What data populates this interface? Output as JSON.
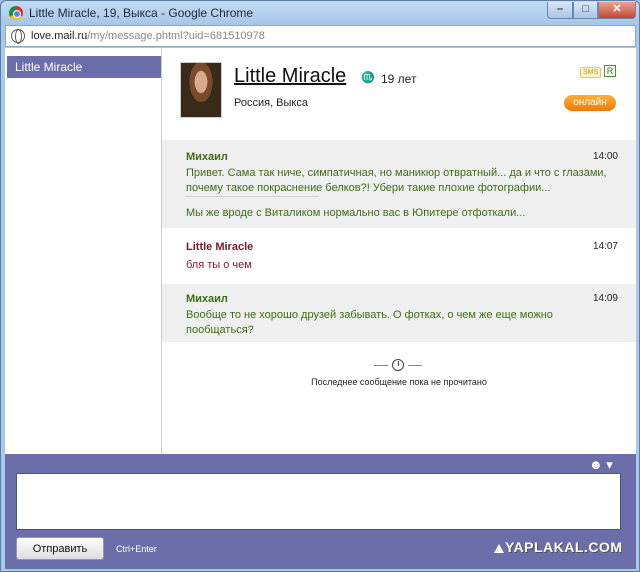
{
  "window": {
    "title": "Little Miracle, 19, Выкса - Google Chrome",
    "controls": {
      "minimize": "–",
      "maximize": "□",
      "close": "✕"
    }
  },
  "address": {
    "host": "love.mail.ru",
    "path": "/my/message.phtml?uid=681510978"
  },
  "sidebar": {
    "items": [
      {
        "label": "Little Miracle",
        "selected": true
      }
    ]
  },
  "profile": {
    "name": "Little Miracle",
    "zodiac_icon": "zodiac-sign-icon",
    "age": "19 лет",
    "location": "Россия, Выкса",
    "sms_badge": "SMS",
    "r_badge": "R",
    "online_label": "онлайн"
  },
  "messages": [
    {
      "author": "Михаил",
      "time": "14:00",
      "text": "Привет. Сама так ниче, симпатичная, но маникюр отвратный... да и что с глазами, почему такое покраснение белков?! Убери такие плохие фотографии...",
      "extra": "Мы же вроде с Виталиком нормально вас в Юпитере отфоткали..."
    },
    {
      "author": "Little Miracle",
      "time": "14:07",
      "text": "бля ты о чем"
    },
    {
      "author": "Михаил",
      "time": "14:09",
      "text": "Вообще то не хорошо друзей забывать. О фотках, о чем же еще можно пообщаться?"
    }
  ],
  "status": {
    "text": "Последнее сообщение пока не прочитано"
  },
  "composer": {
    "send_label": "Отправить",
    "hint": "Ctrl+Enter",
    "smiley": "☻ ▾",
    "value": ""
  },
  "watermark": "YAPLAKAL.COM",
  "colors": {
    "accent": "#6b6ea8",
    "online": "#ee7b00",
    "author_green": "#3d6e14",
    "author_red": "#7a1a2a"
  }
}
